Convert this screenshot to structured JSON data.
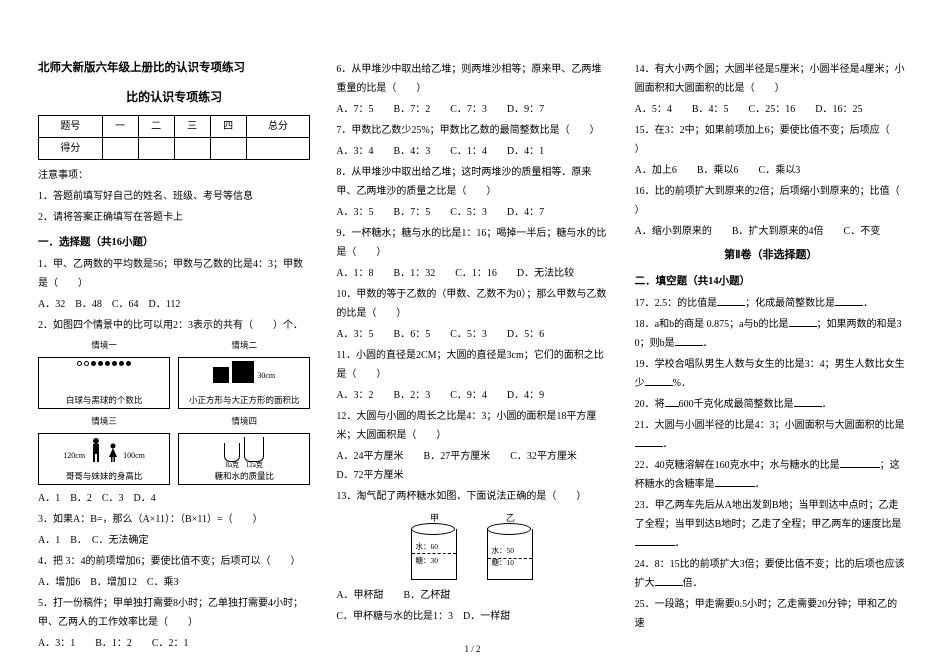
{
  "header": {
    "main_title": "北师大新版六年级上册比的认识专项练习",
    "sub_title": "比的认识专项练习"
  },
  "score_table": {
    "row1": [
      "题号",
      "一",
      "二",
      "三",
      "四",
      "总分"
    ],
    "row2": [
      "得分",
      "",
      "",
      "",
      "",
      ""
    ]
  },
  "notes": {
    "title": "注意事项：",
    "n1": "1．答题前填写好自己的姓名、班级、考号等信息",
    "n2": "2．请将答案正确填写在答题卡上"
  },
  "sect1_title": "一．选择题（共16小题）",
  "col1": {
    "q1": "1．甲、乙两数的平均数是56；甲数与乙数的比是4：3；甲数是（　　）",
    "q1_opts": "A．32　B．48　C．64　D．112",
    "q2": "2．如图四个情景中的比可以用2：3表示的共有（　　）个．",
    "scene_h1": "情境一",
    "scene_h2": "情境二",
    "scene_h3": "情境三",
    "scene_h4": "情境四",
    "scene1_label": "白球与黑球的个数比",
    "scene2_side": "30cm",
    "scene2_label": "小正方形与大正方形的面积比",
    "scene3_h1": "120cm",
    "scene3_h2": "100cm",
    "scene3_label": "哥哥与妹妹的身高比",
    "scene4_s": "8a克",
    "scene4_b": "12a克",
    "scene4_label": "糖和水的质量比",
    "q2_opts": "A．1　B．2　C．3　D．4",
    "q3": "3．如果A：B=，那么（A×11）：（B×11）=（　　）",
    "q3_opts": "A．1　B．　C．无法确定",
    "q4": "4．把 3：4的前项增加6；要使比值不变；后项可以（　　）",
    "q4_opts": "A．增加6　B．增加12　C．乘3",
    "q5": "5．打一份稿件；甲单独打需要8小时；乙单独打需要4小时；甲、乙两人的工作效率比是（　　）",
    "q5_opts": "A．3：1　　B．1：2　　C．2：1"
  },
  "col2": {
    "q6": "6．从甲堆沙中取出给乙堆；则两堆沙相等；原来甲、乙两堆重量的比是（　　）",
    "q6_opts": "A．7：5　　B．7：2　　C．7：3　　D．9：7",
    "q7": "7．甲数比乙数少25%；甲数比乙数的最简整数比是（　　）",
    "q7_opts": "A．3：4　　B．4：3　　C．1：4　　D．4：1",
    "q8": "8．从甲堆沙中取出给乙堆；这时两堆沙的质量相等．原来甲、乙两堆沙的质量之比是（　　）",
    "q8_opts": "A．3：5　　B．7：5　　C．5：3　　D．4：7",
    "q9": "9．一杯糖水；糖与水的比是1：16；喝掉一半后；糖与水的比是（　　）",
    "q9_opts": "A．1：8　　B．1：32　　C．1：16　　D．无法比较",
    "q10": "10．甲数的等于乙数的（甲数、乙数不为0）；那么甲数与乙数的比是（　　）",
    "q10_opts": "A．3：5　　B．6：5　　C．5：3　　D．5：6",
    "q11": "11．小圆的直径是2CM；大圆的直径是3cm；它们的面积之比是（　　）",
    "q11_opts": "A．3：2　　B．2：3　　C．9：4　　D．4：9",
    "q12": "12．大圆与小圆的周长之比是4：3；小圆的面积是18平方厘米；大圆面积是（　　）",
    "q12_opts": "A．24平方厘米　　B．27平方厘米　　C．32平方厘米　　D．72平方厘米",
    "q13": "13．淘气配了两杯糖水如图．下面说法正确的是（　　）",
    "cupA_name": "甲",
    "cupB_name": "乙",
    "cupA_line1": "水：60",
    "cupA_line2": "糖：30",
    "cupB_line1": "水：50",
    "cupB_line2": "糖：10",
    "q13_a": "A．甲杯甜　　B．乙杯甜",
    "q13_b": "C．甲杯糖与水的比是1：3　D．一样甜"
  },
  "col3": {
    "q14": "14．有大小两个圆；大圆半径是5厘米；小圆半径是4厘米；小圆面积和大圆面积的比是（　　）",
    "q14_opts": "A．5：4　　B．4：5　　C．25：16　　D．16：25",
    "q15": "15．在3：2中；如果前项加上6；要使比值不变；后项应（　　）",
    "q15_opts": "A．加上6　　B．乘以6　　C．乘以3",
    "q16": "16．比的前项扩大到原来的2倍；后项缩小到原来的；比值（　　）",
    "q16_opts": "A．缩小到原来的　　B．扩大到原来的4倍　　C．不变",
    "sec2_heading": "第Ⅱ卷（非选择题）",
    "sect2_title": "二．填空题（共14小题）",
    "q17_a": "17．2.5：的比值是",
    "q17_b": "；化成最简整数比是",
    "q17_c": "．",
    "q18_a": "18．a和b的商是 0.875；a与b的比是",
    "q18_b": "；如果两数的和是30；则b是",
    "q18_c": "．",
    "q19_a": "19．学校合唱队男生人数与女生的比是3：4；男生人数比女生少",
    "q19_b": "%．",
    "q20_a": "20．将",
    "q20_b": "600千克化成最简整数比是",
    "q20_c": "．",
    "q21_a": "21．大圆与小圆半径的比是4：3；小圆面积与大圆面积的比是",
    "q21_b": "．",
    "q22_a": "22．40克糖溶解在160克水中；水与糖水的比是",
    "q22_b": "；这杯糖水的含糖率是",
    "q22_c": "．",
    "q23_a": "23．甲乙两车先后从A地出发到B地；当甲到达中点时；乙走了全程；当甲到达B地时；乙走了全程；甲乙两车的速度比是",
    "q23_b": "．",
    "q24_a": "24．8：15比的前项扩大3倍；要使比值不变；比的后项也应该扩大",
    "q24_b": "倍．",
    "q25": "25．一段路；甲走需要0.5小时；乙走需要20分钟；甲和乙的速"
  },
  "footer": "1 / 2"
}
